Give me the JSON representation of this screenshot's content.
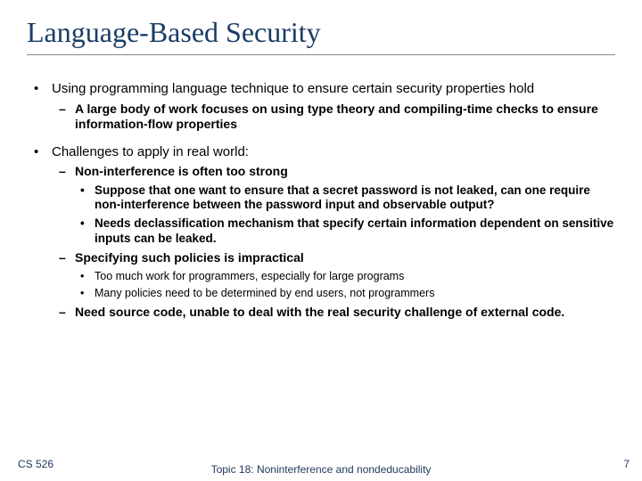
{
  "title": "Language-Based Security",
  "bullets": {
    "b1": "Using programming language technique to ensure certain security properties hold",
    "b1a": "A large body of work focuses on using type theory and compiling-time checks to ensure information-flow properties",
    "b2": "Challenges to apply in real world:",
    "b2a": "Non-interference is often too strong",
    "b2a1": "Suppose that one want to ensure that a secret password is not leaked, can one require non-interference between the password input and observable output?",
    "b2a2": "Needs declassification mechanism that specify certain information dependent on sensitive inputs can be leaked.",
    "b2b": "Specifying such policies is impractical",
    "b2b1": "Too much work for programmers, especially for large programs",
    "b2b2": "Many policies need to be determined by end users, not programmers",
    "b2c": "Need source code, unable to deal with the real security challenge of external code."
  },
  "footer": {
    "left": "CS 526",
    "center": "Topic 18: Noninterference and nondeducability",
    "page": "7"
  }
}
